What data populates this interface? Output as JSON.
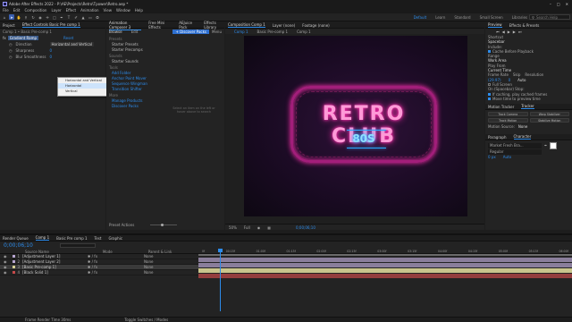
{
  "window": {
    "title": "Adobe After Effects 2022 - P:\\AE\\Projects\\Retro\\Tpower\\Retro.aep *"
  },
  "menu": [
    "File",
    "Edit",
    "Composition",
    "Layer",
    "Effect",
    "Animation",
    "View",
    "Window",
    "Help"
  ],
  "workspaces": [
    "Default",
    "Learn",
    "Standard",
    "Small Screen",
    "Libraries"
  ],
  "search_label": "Search Help",
  "left_panel": {
    "tabs": [
      "Project",
      "Effect Controls Basic Pre comp 1"
    ],
    "breadcrumb": "Comp 1 • Basic Pre-comp 1",
    "effect_name": "Gradient Ramp",
    "reset_label": "Reset",
    "props": [
      {
        "label": "Direction",
        "value": "Horizontal and Vertical"
      },
      {
        "label": "Sharpness",
        "value": "0"
      },
      {
        "label": "Blur Smoothness",
        "value": "0"
      }
    ],
    "dropdown_options": [
      "Horizontal and Vertical",
      "Horizontal",
      "Vertical"
    ],
    "dropdown_selected": "Horizontal"
  },
  "animation_panel": {
    "tabs": [
      "Animation Composer 3",
      "Free Mini Effects",
      "AEJuice Pack",
      "Effects Library"
    ],
    "subtabs": [
      "Browse",
      "Edit"
    ],
    "discover_button": "Discover Packs",
    "menu_label": "Menu",
    "sections": [
      {
        "title": "Presets",
        "items": [
          "Starter Presets",
          "Starter Precomps"
        ]
      },
      {
        "title": "Sounds",
        "items": [
          "Starter Sounds"
        ]
      },
      {
        "title": "Tools",
        "items": [
          "Add Folder",
          "Anchor Point Mover",
          "Sequence Wingman",
          "Transition Shifter"
        ]
      },
      {
        "title": "More",
        "items": [
          "Manage Products",
          "Discover Packs"
        ]
      }
    ],
    "hint": "Select an item on the left or hover above to search",
    "preset_actions": "Preset Actions"
  },
  "composition": {
    "tabs": [
      "Composition Comp 1",
      "Layer (none)",
      "Footage (none)"
    ],
    "view_tabs": [
      "Comp 1",
      "Basic Pre-comp 1",
      "Comp 1"
    ],
    "sign_top": "RETRO CLUB",
    "sign_bottom": "80S",
    "zoom": "50%",
    "resolution": "Full",
    "timecode": "0;00;06;10"
  },
  "right_panel": {
    "tabs": [
      "Preview",
      "Effects & Presets"
    ],
    "shortcut_label": "Shortcut",
    "shortcut_value": "Spacebar",
    "include_label": "Include:",
    "cache_label": "Cache Before Playback",
    "range_label": "Range",
    "range_value": "Work Area",
    "play_from_label": "Play From",
    "play_from_value": "Current Time",
    "frame_rate_label": "Frame Rate",
    "skip_label": "Skip",
    "resolution_label": "Resolution",
    "frame_rate_value": "(29.97)",
    "skip_value": "0",
    "resolution_value": "Auto",
    "fullscreen_label": "Full Screen",
    "stop_label": "On (Spacebar) Stop:",
    "stop_opts": [
      "If caching, play cached frames",
      "Move time to preview time"
    ],
    "tracker_tabs": [
      "Motion Tracker",
      "Tracker"
    ],
    "track_buttons": [
      "Track Camera",
      "Warp Stabilizer",
      "Track Motion",
      "Stabilize Motion"
    ],
    "motion_source_label": "Motion Source:",
    "motion_source_value": "None",
    "paragraph_tabs": [
      "Paragraph",
      "Character"
    ],
    "font_family": "Market Fresh Bra...",
    "font_style": "Regular",
    "font_size": "0 px",
    "leading": "Auto"
  },
  "timeline": {
    "tabs": [
      "Render Queue",
      "Comp 1",
      "Basic Pre comp 1",
      "Test",
      "Graphic"
    ],
    "timecode": "0;00;06;10",
    "header": [
      "Source Name",
      "Mode",
      "Parent & Link"
    ],
    "layers": [
      {
        "num": "1",
        "name": "[Adjustment Layer 1]",
        "color": "#b6a5cf",
        "parent": "None"
      },
      {
        "num": "2",
        "name": "[Adjustment Layer 2]",
        "color": "#b6a5cf",
        "parent": "None"
      },
      {
        "num": "3",
        "name": "[Basic Pre-comp 1]",
        "color": "#d4cf93",
        "parent": "None",
        "selected": true
      },
      {
        "num": "4",
        "name": "[Black Solid 1]",
        "color": "#c54a4a",
        "parent": "None"
      }
    ],
    "ruler": [
      "0f",
      "00:15f",
      "01:00f",
      "01:15f",
      "02:00f",
      "02:15f",
      "03:00f",
      "03:15f",
      "04:00f",
      "04:15f",
      "05:00f",
      "05:15f",
      "06:00f"
    ],
    "footer_left": "Frame Render Time 30ms",
    "footer_mid": "Toggle Switches / Modes"
  }
}
